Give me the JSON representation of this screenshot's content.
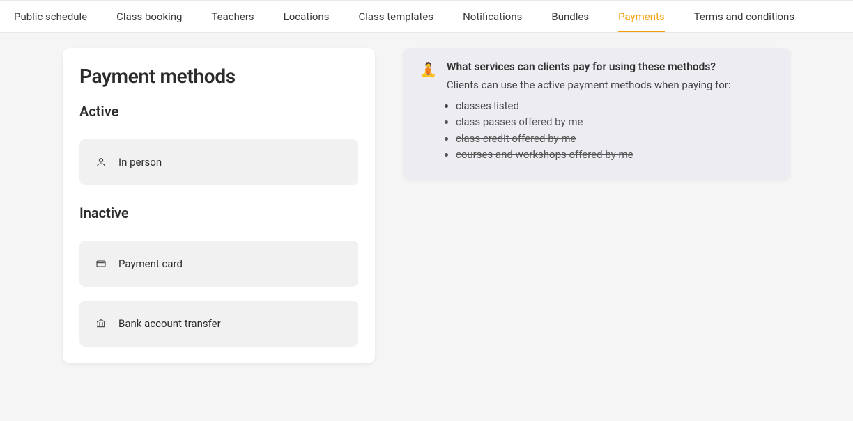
{
  "tabs": [
    {
      "label": "Public schedule",
      "active": false
    },
    {
      "label": "Class booking",
      "active": false
    },
    {
      "label": "Teachers",
      "active": false
    },
    {
      "label": "Locations",
      "active": false
    },
    {
      "label": "Class templates",
      "active": false
    },
    {
      "label": "Notifications",
      "active": false
    },
    {
      "label": "Bundles",
      "active": false
    },
    {
      "label": "Payments",
      "active": true
    },
    {
      "label": "Terms and conditions",
      "active": false
    }
  ],
  "card": {
    "title": "Payment methods",
    "active_heading": "Active",
    "inactive_heading": "Inactive",
    "active_methods": [
      {
        "icon": "person-icon",
        "label": "In person"
      }
    ],
    "inactive_methods": [
      {
        "icon": "card-icon",
        "label": "Payment card"
      },
      {
        "icon": "bank-icon",
        "label": "Bank account transfer"
      }
    ]
  },
  "info": {
    "emoji": "🧘",
    "title": "What services can clients pay for using these methods?",
    "subtitle": "Clients can use the active payment methods when paying for:",
    "items": [
      {
        "text": "classes listed",
        "struck": false
      },
      {
        "text": "class passes offered by me",
        "struck": true
      },
      {
        "text": "class credit offered by me",
        "struck": true
      },
      {
        "text": "courses and workshops offered by me",
        "struck": true
      }
    ]
  }
}
